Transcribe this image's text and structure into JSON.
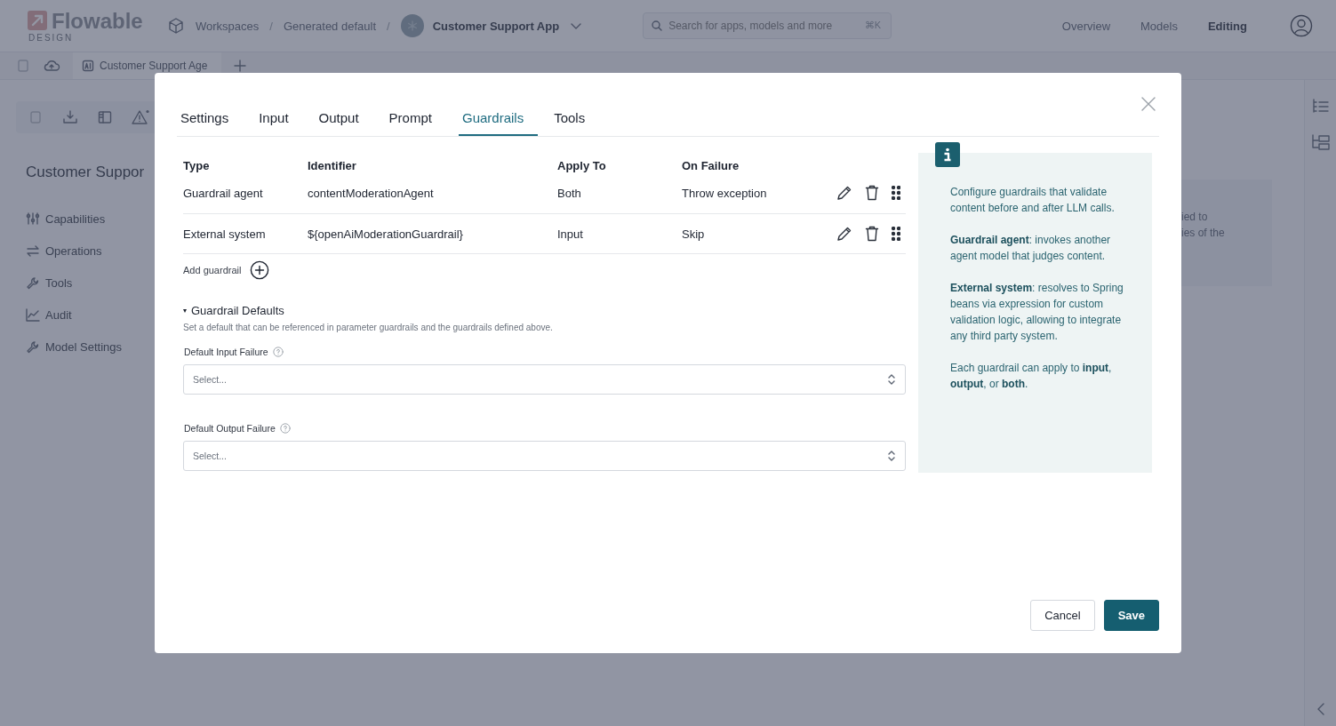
{
  "app": {
    "logo": {
      "name": "Flowable",
      "sub": "DESIGN"
    },
    "breadcrumb": {
      "separator": "/",
      "items": [
        "Workspaces",
        "Generated default",
        "Customer Support App"
      ]
    },
    "search": {
      "placeholder": "Search for apps, models and more",
      "shortcut": "⌘K"
    },
    "nav": [
      {
        "label": "Overview",
        "selected": false
      },
      {
        "label": "Models",
        "selected": false
      },
      {
        "label": "Editing",
        "selected": true
      }
    ],
    "open_tabs": [
      {
        "label": "Customer Support Age"
      }
    ],
    "page_title": "Customer Suppor",
    "sidebar": {
      "items": [
        {
          "label": "Capabilities"
        },
        {
          "label": "Operations"
        },
        {
          "label": "Tools"
        },
        {
          "label": "Audit"
        },
        {
          "label": "Model Settings"
        }
      ]
    },
    "panel_text": [
      "ied to",
      "ies of the"
    ]
  },
  "dialog": {
    "tabs": [
      {
        "label": "Settings",
        "selected": false
      },
      {
        "label": "Input",
        "selected": false
      },
      {
        "label": "Output",
        "selected": false
      },
      {
        "label": "Prompt",
        "selected": false
      },
      {
        "label": "Guardrails",
        "selected": true
      },
      {
        "label": "Tools",
        "selected": false
      }
    ],
    "table": {
      "columns": [
        "Type",
        "Identifier",
        "Apply To",
        "On Failure"
      ],
      "rows": [
        {
          "type": "Guardrail agent",
          "identifier": "contentModerationAgent",
          "apply_to": "Both",
          "on_failure": "Throw exception"
        },
        {
          "type": "External system",
          "identifier": "${openAiModerationGuardrail}",
          "apply_to": "Input",
          "on_failure": "Skip"
        }
      ]
    },
    "add_label": "Add guardrail",
    "defaults": {
      "title": "Guardrail Defaults",
      "expanded": true,
      "description": "Set a default that can be referenced in parameter guardrails and the guardrails defined above.",
      "fields": [
        {
          "label": "Default Input Failure",
          "placeholder": "Select..."
        },
        {
          "label": "Default Output Failure",
          "placeholder": "Select..."
        }
      ]
    },
    "info": [
      "Configure guardrails that validate content before and after LLM calls.",
      "**Guardrail agent**: invokes another agent model that judges content.",
      "**External system**: resolves to Spring beans via expression for custom validation logic, allowing to integrate any third party system.",
      "Each guardrail can apply to **input**, **output**, or **both**."
    ],
    "buttons": [
      {
        "label": "Cancel",
        "kind": "secondary"
      },
      {
        "label": "Save",
        "kind": "primary"
      }
    ]
  }
}
